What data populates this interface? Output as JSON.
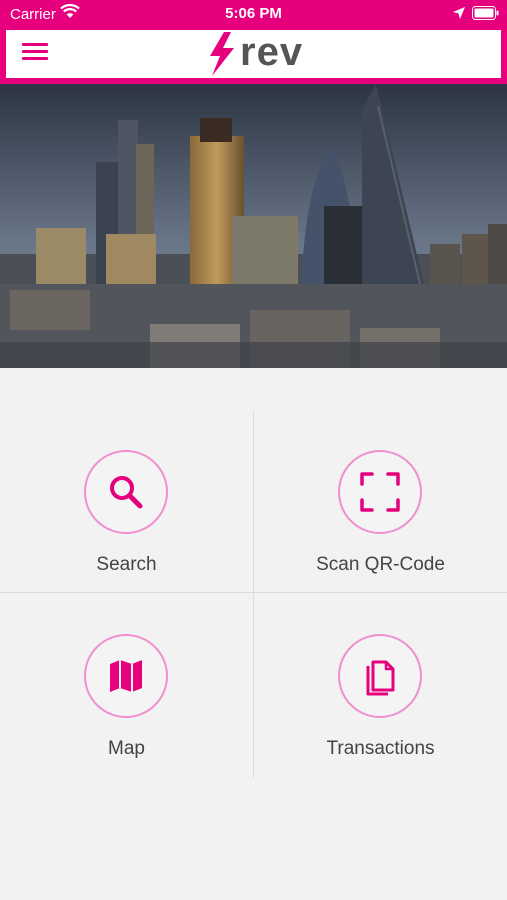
{
  "status_bar": {
    "carrier": "Carrier",
    "time": "5:06 PM"
  },
  "header": {
    "logo_text": "rev",
    "menu_icon": "hamburger-icon",
    "logo_icon": "lightning-bolt-icon"
  },
  "colors": {
    "brand": "#e6007e",
    "accent_light": "#f08fcf",
    "background": "#f2f2f2",
    "text": "#444444"
  },
  "hero": {
    "image": "london-city-skyline-photo"
  },
  "actions": [
    {
      "label": "Search",
      "icon": "search-icon"
    },
    {
      "label": "Scan QR-Code",
      "icon": "qr-scan-icon"
    },
    {
      "label": "Map",
      "icon": "map-icon"
    },
    {
      "label": "Transactions",
      "icon": "documents-icon"
    }
  ]
}
